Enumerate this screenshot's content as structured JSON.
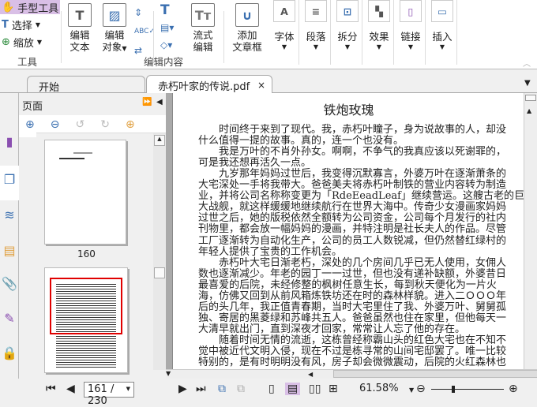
{
  "ribbon": {
    "tools": {
      "hand": "手型工具",
      "select": "选择",
      "zoom": "缩放",
      "group": "工具"
    },
    "edit": {
      "edit_text": [
        "编辑",
        "文本"
      ],
      "edit_object": [
        "编辑",
        "对象"
      ],
      "flow_edit": [
        "流式",
        "编辑"
      ],
      "add_frame": [
        "添加",
        "文章框"
      ],
      "group": "编辑内容"
    },
    "format": [
      "字体",
      "段落",
      "拆分",
      "效果",
      "链接",
      "插入"
    ]
  },
  "tabs": [
    {
      "label": "开始"
    },
    {
      "label": "赤朽叶家的传说.pdf",
      "close": "×"
    }
  ],
  "panel": {
    "title": "页面",
    "thumb_label": "160"
  },
  "document": {
    "title": "铁炮玫瑰",
    "paragraphs": [
      [
        "时间终于来到了现代。我，赤朽叶瞳子，身为说故事的人，却没",
        "什么值得一提的故事。真的，连一个也没有。"
      ],
      [
        "我是万叶的不肖外孙女。啊啊，不争气的我真应该以死谢罪的，",
        "可是我还想再活久一点。"
      ],
      [
        "九岁那年妈妈过世后，我变得沉默寡言，外婆万叶在逐渐萧条的",
        "大宅深处一手将我带大。爸爸美夫将赤朽叶制铁的营业内容转为制造",
        "业，并将公司名称称变更为「RdeEeadLeaf」继续营运。这艘古老的巨",
        "大战舰，就这样缓缓地继续航行在世界大海中。传奇少女漫画家妈妈",
        "过世之后，她的版税依然全额转为公司资金，公司每个月发行的社内",
        "刊物里，都会放一幅妈妈的漫画，并特注明是社长夫人的作品。尽管",
        "工厂逐渐转为自动化生产，公司的员工人数锐减，但仍然替红绿村的",
        "年轻人提供了宝贵的工作机会。"
      ],
      [
        "赤朽叶大宅日渐老朽，深处的几个房间几乎已无人使用，女佣人",
        "数也逐渐减少。年老的园丁一一过世，但也没有递补缺额，外婆昔日",
        "最喜爱的后院，未经修整的枫树任意生长，每到秋天便化为一片火",
        "海，仿佛又回到从前风箱炼铁坊还在时的森林样貌。进入二ＯＯＯ年",
        "后的头几年，我正值青春期，当时大宅里住了我、外婆万叶、舅舅孤",
        "独、寄居的黑菱绿和苏峰共五人。爸爸虽然也住在家里，但他每天一",
        "大清早就出门，直到深夜才回家，常常让人忘了他的存在。"
      ],
      [
        "随着时间无情的流逝，这栋曾经称霸山头的红色大宅也在不知不",
        "觉中被近代文明入侵，现在不过是栋寻常的山间宅邸罢了。唯一比较",
        "特别的，是有时明明没有风，房子却会微微震动，后院的火红森林也"
      ]
    ]
  },
  "status": {
    "page": "161 / 230",
    "zoom": "61.58%",
    "zoom_fraction": 0.3
  },
  "colors": {
    "accent": "#3a6fb0",
    "selected": "#d9bfe6",
    "highlight_rect": "#e00000"
  }
}
